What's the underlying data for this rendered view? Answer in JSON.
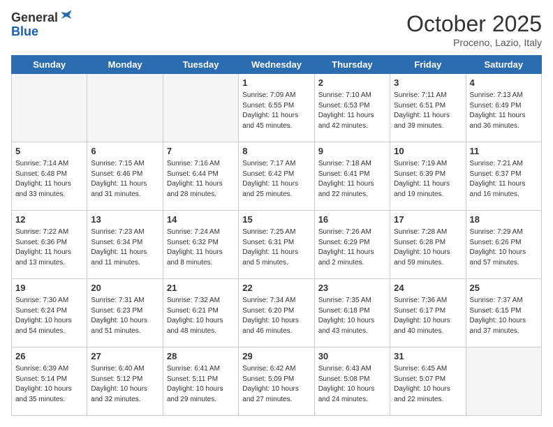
{
  "logo": {
    "general": "General",
    "blue": "Blue"
  },
  "header": {
    "month": "October 2025",
    "location": "Proceno, Lazio, Italy"
  },
  "days_of_week": [
    "Sunday",
    "Monday",
    "Tuesday",
    "Wednesday",
    "Thursday",
    "Friday",
    "Saturday"
  ],
  "weeks": [
    [
      {
        "day": "",
        "info": ""
      },
      {
        "day": "",
        "info": ""
      },
      {
        "day": "",
        "info": ""
      },
      {
        "day": "1",
        "info": "Sunrise: 7:09 AM\nSunset: 6:55 PM\nDaylight: 11 hours\nand 45 minutes."
      },
      {
        "day": "2",
        "info": "Sunrise: 7:10 AM\nSunset: 6:53 PM\nDaylight: 11 hours\nand 42 minutes."
      },
      {
        "day": "3",
        "info": "Sunrise: 7:11 AM\nSunset: 6:51 PM\nDaylight: 11 hours\nand 39 minutes."
      },
      {
        "day": "4",
        "info": "Sunrise: 7:13 AM\nSunset: 6:49 PM\nDaylight: 11 hours\nand 36 minutes."
      }
    ],
    [
      {
        "day": "5",
        "info": "Sunrise: 7:14 AM\nSunset: 6:48 PM\nDaylight: 11 hours\nand 33 minutes."
      },
      {
        "day": "6",
        "info": "Sunrise: 7:15 AM\nSunset: 6:46 PM\nDaylight: 11 hours\nand 31 minutes."
      },
      {
        "day": "7",
        "info": "Sunrise: 7:16 AM\nSunset: 6:44 PM\nDaylight: 11 hours\nand 28 minutes."
      },
      {
        "day": "8",
        "info": "Sunrise: 7:17 AM\nSunset: 6:42 PM\nDaylight: 11 hours\nand 25 minutes."
      },
      {
        "day": "9",
        "info": "Sunrise: 7:18 AM\nSunset: 6:41 PM\nDaylight: 11 hours\nand 22 minutes."
      },
      {
        "day": "10",
        "info": "Sunrise: 7:19 AM\nSunset: 6:39 PM\nDaylight: 11 hours\nand 19 minutes."
      },
      {
        "day": "11",
        "info": "Sunrise: 7:21 AM\nSunset: 6:37 PM\nDaylight: 11 hours\nand 16 minutes."
      }
    ],
    [
      {
        "day": "12",
        "info": "Sunrise: 7:22 AM\nSunset: 6:36 PM\nDaylight: 11 hours\nand 13 minutes."
      },
      {
        "day": "13",
        "info": "Sunrise: 7:23 AM\nSunset: 6:34 PM\nDaylight: 11 hours\nand 11 minutes."
      },
      {
        "day": "14",
        "info": "Sunrise: 7:24 AM\nSunset: 6:32 PM\nDaylight: 11 hours\nand 8 minutes."
      },
      {
        "day": "15",
        "info": "Sunrise: 7:25 AM\nSunset: 6:31 PM\nDaylight: 11 hours\nand 5 minutes."
      },
      {
        "day": "16",
        "info": "Sunrise: 7:26 AM\nSunset: 6:29 PM\nDaylight: 11 hours\nand 2 minutes."
      },
      {
        "day": "17",
        "info": "Sunrise: 7:28 AM\nSunset: 6:28 PM\nDaylight: 10 hours\nand 59 minutes."
      },
      {
        "day": "18",
        "info": "Sunrise: 7:29 AM\nSunset: 6:26 PM\nDaylight: 10 hours\nand 57 minutes."
      }
    ],
    [
      {
        "day": "19",
        "info": "Sunrise: 7:30 AM\nSunset: 6:24 PM\nDaylight: 10 hours\nand 54 minutes."
      },
      {
        "day": "20",
        "info": "Sunrise: 7:31 AM\nSunset: 6:23 PM\nDaylight: 10 hours\nand 51 minutes."
      },
      {
        "day": "21",
        "info": "Sunrise: 7:32 AM\nSunset: 6:21 PM\nDaylight: 10 hours\nand 48 minutes."
      },
      {
        "day": "22",
        "info": "Sunrise: 7:34 AM\nSunset: 6:20 PM\nDaylight: 10 hours\nand 46 minutes."
      },
      {
        "day": "23",
        "info": "Sunrise: 7:35 AM\nSunset: 6:18 PM\nDaylight: 10 hours\nand 43 minutes."
      },
      {
        "day": "24",
        "info": "Sunrise: 7:36 AM\nSunset: 6:17 PM\nDaylight: 10 hours\nand 40 minutes."
      },
      {
        "day": "25",
        "info": "Sunrise: 7:37 AM\nSunset: 6:15 PM\nDaylight: 10 hours\nand 37 minutes."
      }
    ],
    [
      {
        "day": "26",
        "info": "Sunrise: 6:39 AM\nSunset: 5:14 PM\nDaylight: 10 hours\nand 35 minutes."
      },
      {
        "day": "27",
        "info": "Sunrise: 6:40 AM\nSunset: 5:12 PM\nDaylight: 10 hours\nand 32 minutes."
      },
      {
        "day": "28",
        "info": "Sunrise: 6:41 AM\nSunset: 5:11 PM\nDaylight: 10 hours\nand 29 minutes."
      },
      {
        "day": "29",
        "info": "Sunrise: 6:42 AM\nSunset: 5:09 PM\nDaylight: 10 hours\nand 27 minutes."
      },
      {
        "day": "30",
        "info": "Sunrise: 6:43 AM\nSunset: 5:08 PM\nDaylight: 10 hours\nand 24 minutes."
      },
      {
        "day": "31",
        "info": "Sunrise: 6:45 AM\nSunset: 5:07 PM\nDaylight: 10 hours\nand 22 minutes."
      },
      {
        "day": "",
        "info": ""
      }
    ]
  ]
}
